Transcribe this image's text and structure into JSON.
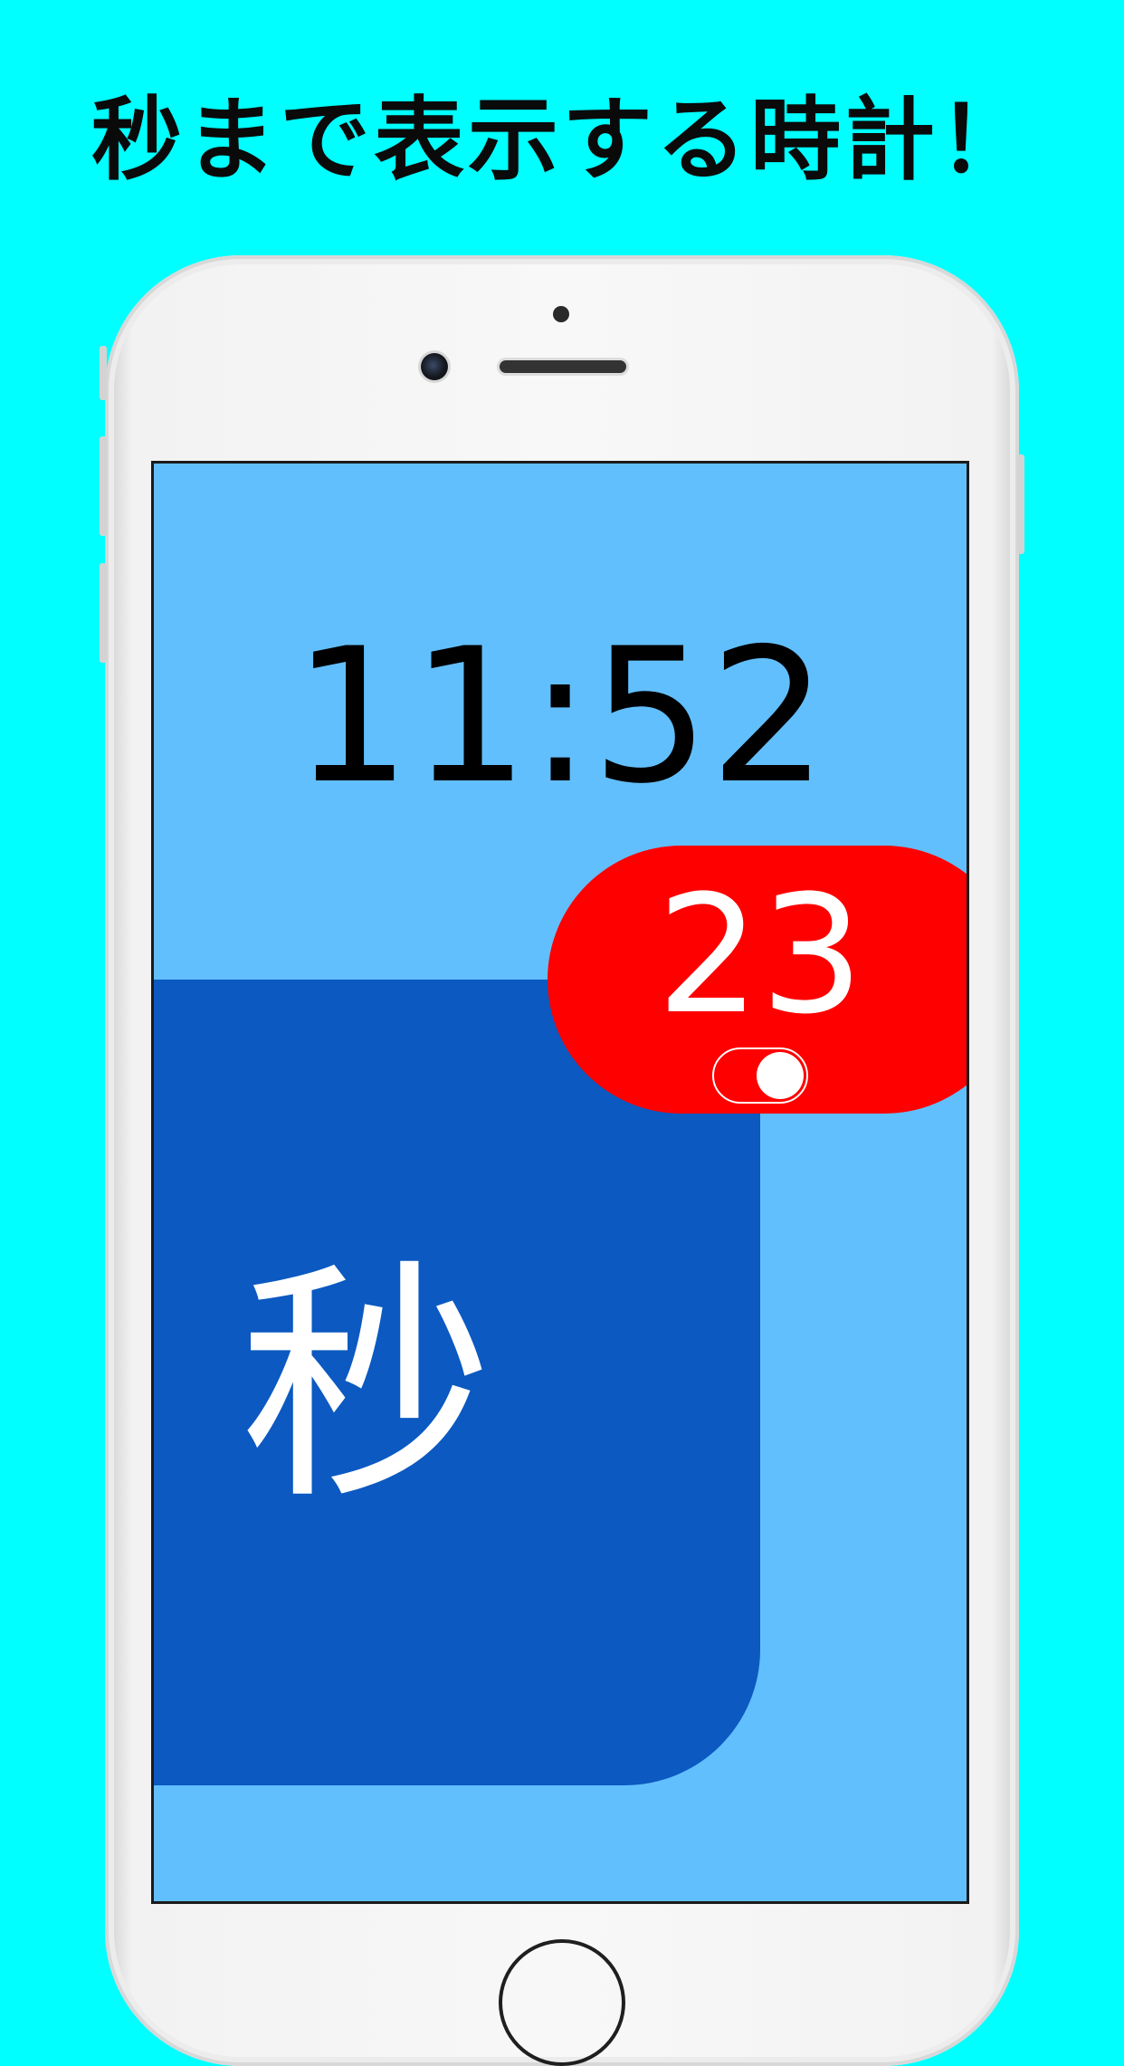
{
  "headline": "秒まで表示する時計！",
  "clock": {
    "time": "11:52",
    "seconds": "23",
    "kanji_label": "秒",
    "seconds_toggle_on": true
  },
  "colors": {
    "background": "#00ffff",
    "screen": "#62bffd",
    "panel": "#0b59c1",
    "badge": "#ff0000",
    "text_dark": "#000000",
    "text_light": "#ffffff"
  }
}
